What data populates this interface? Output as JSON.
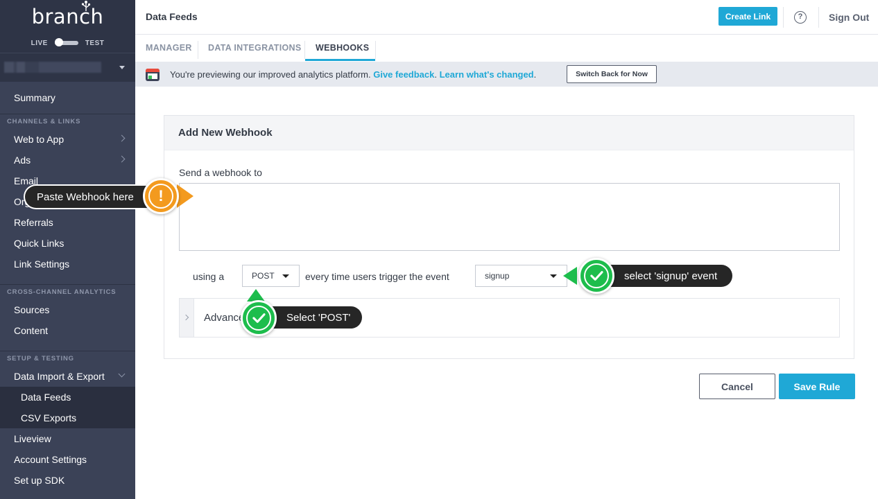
{
  "brand": {
    "logo_text": "branch"
  },
  "env": {
    "live_label": "LIVE",
    "test_label": "TEST"
  },
  "sidebar": {
    "summary": "Summary",
    "sections": {
      "channels": "CHANNELS & LINKS",
      "analytics": "CROSS-CHANNEL ANALYTICS",
      "setup": "SETUP & TESTING"
    },
    "channels_items": [
      "Web to App",
      "Ads",
      "Email",
      "Organic Search",
      "Referrals",
      "Quick Links",
      "Link Settings"
    ],
    "analytics_items": [
      "Sources",
      "Content"
    ],
    "setup_items": [
      "Data Import & Export"
    ],
    "setup_subitems": [
      "Data Feeds",
      "CSV Exports"
    ],
    "bottom_items": [
      "Liveview",
      "Account Settings",
      "Set up SDK"
    ]
  },
  "header": {
    "title": "Data Feeds",
    "create_link": "Create Link",
    "help": "?",
    "sign_out": "Sign Out"
  },
  "tabs": [
    "MANAGER",
    "DATA INTEGRATIONS",
    "WEBHOOKS"
  ],
  "banner": {
    "text": "You're previewing our improved analytics platform.",
    "feedback_link": "Give feedback",
    "changed_link": "Learn what's changed",
    "switch_button": "Switch Back for Now"
  },
  "form": {
    "title": "Add New Webhook",
    "send_label": "Send a webhook to",
    "webhook_url": "",
    "using_label": "using a",
    "method": "POST",
    "trigger_label": "every time users trigger the event",
    "event": "signup",
    "advanced_label": "Advanced"
  },
  "actions": {
    "cancel": "Cancel",
    "save": "Save Rule"
  },
  "callouts": {
    "webhook": "Paste Webhook here",
    "event": "select 'signup' event",
    "method": "Select 'POST'"
  },
  "colors": {
    "accent": "#1fa8d6",
    "sidebar": "#3b4257",
    "callout_orange": "#f39a1e",
    "callout_green": "#1dbd4c"
  }
}
